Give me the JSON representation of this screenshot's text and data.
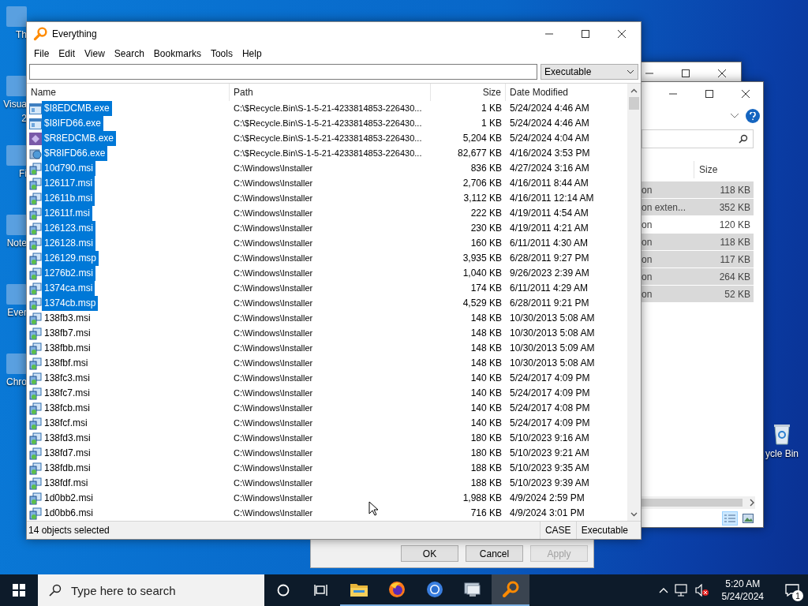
{
  "desktop_icons": [
    {
      "lines": [
        "Th"
      ]
    },
    {
      "lines": [
        "Visua",
        "2"
      ]
    },
    {
      "lines": [
        "Fi"
      ]
    },
    {
      "lines": [
        "Note"
      ]
    },
    {
      "lines": [
        "Ever"
      ]
    },
    {
      "lines": [
        "Chro"
      ]
    }
  ],
  "recycle_bin": {
    "label": "ycle Bin"
  },
  "explorer_window": {
    "header": "Size",
    "rows": [
      {
        "name": "on",
        "size": "118 KB",
        "selected": true
      },
      {
        "name": "on exten...",
        "size": "352 KB",
        "selected": true
      },
      {
        "name": "on",
        "size": "120 KB",
        "selected": false
      },
      {
        "name": "on",
        "size": "118 KB",
        "selected": true
      },
      {
        "name": "on",
        "size": "117 KB",
        "selected": true
      },
      {
        "name": "on",
        "size": "264 KB",
        "selected": true
      },
      {
        "name": "on",
        "size": "52 KB",
        "selected": true
      }
    ]
  },
  "dialog": {
    "buttons": [
      {
        "label": "OK",
        "disabled": false
      },
      {
        "label": "Cancel",
        "disabled": false
      },
      {
        "label": "Apply",
        "disabled": true
      }
    ]
  },
  "window": {
    "title": "Everything",
    "menu": [
      "File",
      "Edit",
      "View",
      "Search",
      "Bookmarks",
      "Tools",
      "Help"
    ],
    "filter": "Executable",
    "columns": [
      "Name",
      "Path",
      "Size",
      "Date Modified"
    ],
    "rows": [
      {
        "kind": "app",
        "name": "$I8EDCMB.exe",
        "path": "C:\\$Recycle.Bin\\S-1-5-21-4233814853-226430...",
        "size": "1 KB",
        "date": "5/24/2024 4:46 AM",
        "selected": true
      },
      {
        "kind": "app",
        "name": "$I8IFD66.exe",
        "path": "C:\\$Recycle.Bin\\S-1-5-21-4233814853-226430...",
        "size": "1 KB",
        "date": "5/24/2024 4:46 AM",
        "selected": true
      },
      {
        "kind": "purple",
        "name": "$R8EDCMB.exe",
        "path": "C:\\$Recycle.Bin\\S-1-5-21-4233814853-226430...",
        "size": "5,204 KB",
        "date": "5/24/2024 4:04 AM",
        "selected": true
      },
      {
        "kind": "setup",
        "name": "$R8IFD66.exe",
        "path": "C:\\$Recycle.Bin\\S-1-5-21-4233814853-226430...",
        "size": "82,677 KB",
        "date": "4/16/2024 3:53 PM",
        "selected": true
      },
      {
        "kind": "msi",
        "name": "10d790.msi",
        "path": "C:\\Windows\\Installer",
        "size": "836 KB",
        "date": "4/27/2024 3:16 AM",
        "selected": true
      },
      {
        "kind": "msi",
        "name": "126117.msi",
        "path": "C:\\Windows\\Installer",
        "size": "2,706 KB",
        "date": "4/16/2011 8:44 AM",
        "selected": true
      },
      {
        "kind": "msi",
        "name": "12611b.msi",
        "path": "C:\\Windows\\Installer",
        "size": "3,112 KB",
        "date": "4/16/2011 12:14 AM",
        "selected": true
      },
      {
        "kind": "msi",
        "name": "12611f.msi",
        "path": "C:\\Windows\\Installer",
        "size": "222 KB",
        "date": "4/19/2011 4:54 AM",
        "selected": true
      },
      {
        "kind": "msi",
        "name": "126123.msi",
        "path": "C:\\Windows\\Installer",
        "size": "230 KB",
        "date": "4/19/2011 4:21 AM",
        "selected": true
      },
      {
        "kind": "msi",
        "name": "126128.msi",
        "path": "C:\\Windows\\Installer",
        "size": "160 KB",
        "date": "6/11/2011 4:30 AM",
        "selected": true
      },
      {
        "kind": "msi",
        "name": "126129.msp",
        "path": "C:\\Windows\\Installer",
        "size": "3,935 KB",
        "date": "6/28/2011 9:27 PM",
        "selected": true
      },
      {
        "kind": "msi",
        "name": "1276b2.msi",
        "path": "C:\\Windows\\Installer",
        "size": "1,040 KB",
        "date": "9/26/2023 2:39 AM",
        "selected": true
      },
      {
        "kind": "msi",
        "name": "1374ca.msi",
        "path": "C:\\Windows\\Installer",
        "size": "174 KB",
        "date": "6/11/2011 4:29 AM",
        "selected": true
      },
      {
        "kind": "msi",
        "name": "1374cb.msp",
        "path": "C:\\Windows\\Installer",
        "size": "4,529 KB",
        "date": "6/28/2011 9:21 PM",
        "selected": true
      },
      {
        "kind": "msi",
        "name": "138fb3.msi",
        "path": "C:\\Windows\\Installer",
        "size": "148 KB",
        "date": "10/30/2013 5:08 AM",
        "selected": false
      },
      {
        "kind": "msi",
        "name": "138fb7.msi",
        "path": "C:\\Windows\\Installer",
        "size": "148 KB",
        "date": "10/30/2013 5:08 AM",
        "selected": false
      },
      {
        "kind": "msi",
        "name": "138fbb.msi",
        "path": "C:\\Windows\\Installer",
        "size": "148 KB",
        "date": "10/30/2013 5:09 AM",
        "selected": false
      },
      {
        "kind": "msi",
        "name": "138fbf.msi",
        "path": "C:\\Windows\\Installer",
        "size": "148 KB",
        "date": "10/30/2013 5:08 AM",
        "selected": false
      },
      {
        "kind": "msi",
        "name": "138fc3.msi",
        "path": "C:\\Windows\\Installer",
        "size": "140 KB",
        "date": "5/24/2017 4:09 PM",
        "selected": false
      },
      {
        "kind": "msi",
        "name": "138fc7.msi",
        "path": "C:\\Windows\\Installer",
        "size": "140 KB",
        "date": "5/24/2017 4:09 PM",
        "selected": false
      },
      {
        "kind": "msi",
        "name": "138fcb.msi",
        "path": "C:\\Windows\\Installer",
        "size": "140 KB",
        "date": "5/24/2017 4:08 PM",
        "selected": false
      },
      {
        "kind": "msi",
        "name": "138fcf.msi",
        "path": "C:\\Windows\\Installer",
        "size": "140 KB",
        "date": "5/24/2017 4:09 PM",
        "selected": false
      },
      {
        "kind": "msi",
        "name": "138fd3.msi",
        "path": "C:\\Windows\\Installer",
        "size": "180 KB",
        "date": "5/10/2023 9:16 AM",
        "selected": false
      },
      {
        "kind": "msi",
        "name": "138fd7.msi",
        "path": "C:\\Windows\\Installer",
        "size": "180 KB",
        "date": "5/10/2023 9:21 AM",
        "selected": false
      },
      {
        "kind": "msi",
        "name": "138fdb.msi",
        "path": "C:\\Windows\\Installer",
        "size": "188 KB",
        "date": "5/10/2023 9:35 AM",
        "selected": false
      },
      {
        "kind": "msi",
        "name": "138fdf.msi",
        "path": "C:\\Windows\\Installer",
        "size": "188 KB",
        "date": "5/10/2023 9:39 AM",
        "selected": false
      },
      {
        "kind": "msi",
        "name": "1d0bb2.msi",
        "path": "C:\\Windows\\Installer",
        "size": "1,988 KB",
        "date": "4/9/2024 2:59 PM",
        "selected": false
      },
      {
        "kind": "msi",
        "name": "1d0bb6.msi",
        "path": "C:\\Windows\\Installer",
        "size": "716 KB",
        "date": "4/9/2024 3:01 PM",
        "selected": false
      }
    ],
    "status": "14 objects selected",
    "status_flags": [
      "CASE",
      "Executable"
    ]
  },
  "taskbar": {
    "search_placeholder": "Type here to search",
    "apps": [
      {
        "kind": "folder",
        "selected": false
      },
      {
        "kind": "firefox",
        "selected": false
      },
      {
        "kind": "chrome",
        "selected": false
      },
      {
        "kind": "monitor",
        "selected": false
      },
      {
        "kind": "everything",
        "selected": true
      }
    ],
    "time": "5:20 AM",
    "date": "5/24/2024",
    "notifications": "1"
  }
}
